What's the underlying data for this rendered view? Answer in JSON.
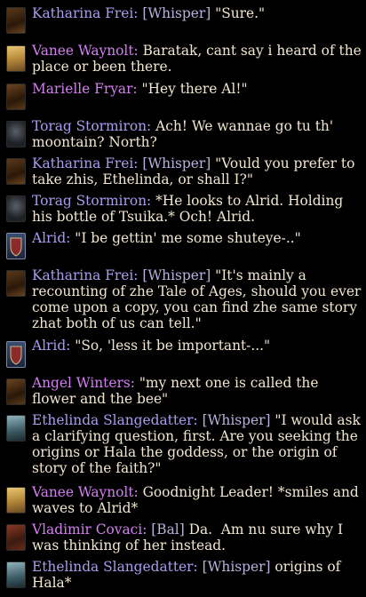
{
  "colors": {
    "text": "#f1e6cf",
    "name_katharina": "#a99cf0",
    "name_vanee": "#d47ff0",
    "name_marielle": "#d47ff0",
    "name_torag": "#a99cf0",
    "name_alrid": "#a99cf0",
    "name_angel": "#d47ff0",
    "name_ethelinda": "#a99cf0",
    "name_vladimir": "#d47ff0",
    "channel": "#b9b1e0"
  },
  "messages": [
    {
      "avatar": "elf-portrait-icon",
      "name": "Katharina Frei:",
      "channel": " [Whisper]",
      "text": " \"Sure.\""
    },
    {
      "avatar": "blonde-portrait-icon",
      "name": "Vanee Waynolt:",
      "channel": "",
      "text": " Baratak, cant say i heard of the place or been there."
    },
    {
      "avatar": "elf-portrait-icon",
      "name": "Marielle Fryar:",
      "channel": "",
      "text": " \"Hey there Al!\""
    },
    {
      "avatar": "helmet-portrait-icon",
      "name": "Torag Stormiron:",
      "channel": "",
      "text": " Ach! We wannae go tu th' moontain? North?"
    },
    {
      "avatar": "elf-portrait-icon",
      "name": "Katharina Frei:",
      "channel": " [Whisper]",
      "text": " \"Vould you prefer to take zhis, Ethelinda, or shall I?\""
    },
    {
      "avatar": "helmet-portrait-icon",
      "name": "Torag Stormiron:",
      "channel": "",
      "text": " *He looks to Alrid. Holding his bottle of Tsuika.* Och! Alrid."
    },
    {
      "avatar": "shield-portrait-icon",
      "name": "Alrid:",
      "channel": "",
      "text": " \"I be gettin' me some shuteye-..\""
    },
    {
      "avatar": "elf-portrait-icon",
      "name": "Katharina Frei:",
      "channel": " [Whisper]",
      "text": " \"It's mainly a recounting of zhe Tale of Ages, should you ever come upon a copy, you can find zhe same story zhat both of us can tell.\""
    },
    {
      "avatar": "shield-portrait-icon",
      "name": "Alrid:",
      "channel": "",
      "text": " \"So, 'less it be important-...\""
    },
    {
      "avatar": "elf-portrait-icon",
      "name": "Angel Winters:",
      "channel": "",
      "text": " \"my next one is called the flower and the bee\""
    },
    {
      "avatar": "hooded-portrait-icon",
      "name": "Ethelinda Slangedatter:",
      "channel": " [Whisper]",
      "text": " \"I would ask a clarifying question, first. Are you seeking the origins or Hala the goddess, or the origin of story of the faith?\""
    },
    {
      "avatar": "blonde-portrait-icon",
      "name": "Vanee Waynolt:",
      "channel": "",
      "text": " Goodnight Leader! *smiles and waves to Alrid*"
    },
    {
      "avatar": "bearded-portrait-icon",
      "name": "Vladimir Covaci:",
      "channel": " [Bal]",
      "text": " Da.  Am nu sure why I was thinking of her instead."
    },
    {
      "avatar": "hooded-portrait-icon",
      "name": "Ethelinda Slangedatter:",
      "channel": " [Whisper]",
      "text": " origins of Hala*"
    }
  ]
}
